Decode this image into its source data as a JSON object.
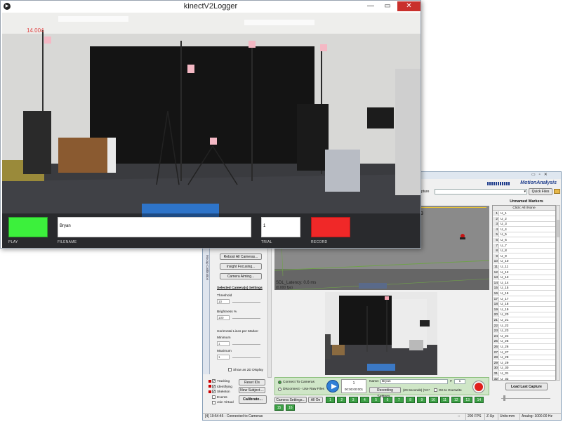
{
  "kinect": {
    "title": "kinectV2Logger",
    "counter": "14.004",
    "filename_value": "Bryan",
    "trial_value": "1",
    "labels": {
      "play": "PLAY",
      "filename": "FILENAME",
      "trial": "TRIAL",
      "record": "RECORD"
    },
    "colors": {
      "play": "#3cf03c",
      "record": "#f02828"
    }
  },
  "ma": {
    "brand": "MotionAnalysis",
    "capture_label": "pture",
    "quick_files": "Quick Files",
    "unnamed_title": "Unnamed Markers",
    "click_all_none": "Click: All /None",
    "markers": [
      "U_1",
      "U_2",
      "U_3",
      "U_4",
      "U_5",
      "U_6",
      "U_7",
      "U_8",
      "U_9",
      "U_10",
      "U_11",
      "U_12",
      "U_13",
      "U_14",
      "U_15",
      "U_16",
      "U_17",
      "U_18",
      "U_19",
      "U_20",
      "U_21",
      "U_22",
      "U_23",
      "U_24",
      "U_25",
      "U_26",
      "U_27",
      "U_28",
      "U_29",
      "U_30",
      "U_31",
      "U_32"
    ],
    "load_last": "Load Last Capture",
    "side_tabs": "Mocap  Calibration",
    "reboot": "Reboot All Cameras...",
    "insight": "Insight Focusing...",
    "aiming": "Camera Aiming...",
    "selected_title": "Selected Camera(s) Settings",
    "threshold": "Threshold",
    "threshold_val": "10",
    "brightness": "Brightness %",
    "brightness_val": "100",
    "hlines": "Horizontal Lines per Marker",
    "minimum": "Minimum",
    "min_val": "1",
    "maximum": "Maximum",
    "max_val": "1",
    "show2d": "Show as 2D Display",
    "overlay_a": "SDL_Latency: 0.6 ms",
    "overlay_b": "(0.000 fps)",
    "overlay_c": "3",
    "checks": [
      {
        "label": "Tracking",
        "on": true
      },
      {
        "label": "Identifying",
        "on": true
      },
      {
        "label": "Skeleton",
        "on": true
      },
      {
        "label": "Events",
        "on": false
      },
      {
        "label": "Join Virtual",
        "on": false
      }
    ],
    "reset_ids": "Reset IDs",
    "new_subject": "New Subject....",
    "calibrate": "Calibrate...",
    "connect": "Connect To Cameras",
    "disconnect": "Disconnect - Use Raw Files",
    "play_counter": "1",
    "timecode": "00:00:00:001",
    "name_label": "Name:",
    "name_value": "Bryan",
    "name_hash": "#",
    "name_num": "1",
    "rec_settings": "Recording Settings...",
    "rec_duration": "(20 Seconds) (VC*",
    "ok_overwrite": "OK to Overwrite",
    "cam_settings": "Camera Settings...",
    "all_on": "All On",
    "cams": [
      "1",
      "2",
      "3",
      "4",
      "5",
      "6",
      "7",
      "8",
      "9",
      "10",
      "11",
      "12",
      "13",
      "14",
      "15",
      "16"
    ],
    "status_left": "[4] 19:54:45 - Connected to Cameras",
    "status_dash": "--",
    "fps": "200 FPS",
    "zup": "Z-Up",
    "units": "Units:mm",
    "analog": "Analog: 1000.00 Hz"
  }
}
